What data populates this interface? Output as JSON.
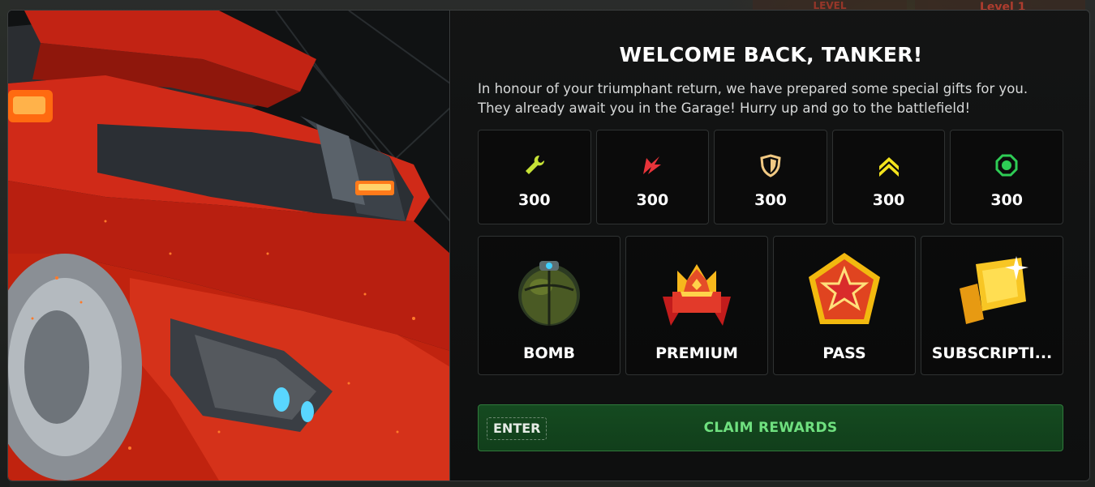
{
  "background": {
    "level_tab_left": "LEVEL",
    "level_tab_right": "Level 1"
  },
  "dialog": {
    "title": "WELCOME BACK, TANKER!",
    "description_line1": "In honour of your triumphant return, we have prepared some special gifts for you.",
    "description_line2": "They already await you in the Garage! Hurry up and go to the battlefield!",
    "resources": [
      {
        "icon": "repair-kit-icon",
        "value": "300",
        "color": "#c6e236"
      },
      {
        "icon": "double-damage-icon",
        "value": "300",
        "color": "#e8343a"
      },
      {
        "icon": "double-armor-icon",
        "value": "300",
        "color": "#f1c983"
      },
      {
        "icon": "speed-boost-icon",
        "value": "300",
        "color": "#f3e31d"
      },
      {
        "icon": "mine-icon",
        "value": "300",
        "color": "#2ecc55"
      }
    ],
    "items": [
      {
        "icon": "bomb-icon",
        "label": "BOMB"
      },
      {
        "icon": "premium-crown-icon",
        "label": "PREMIUM"
      },
      {
        "icon": "pass-star-icon",
        "label": "PASS"
      },
      {
        "icon": "subscription-crystal-icon",
        "label": "SUBSCRIPTI..."
      }
    ],
    "claim": {
      "hotkey": "ENTER",
      "label": "CLAIM REWARDS"
    }
  }
}
